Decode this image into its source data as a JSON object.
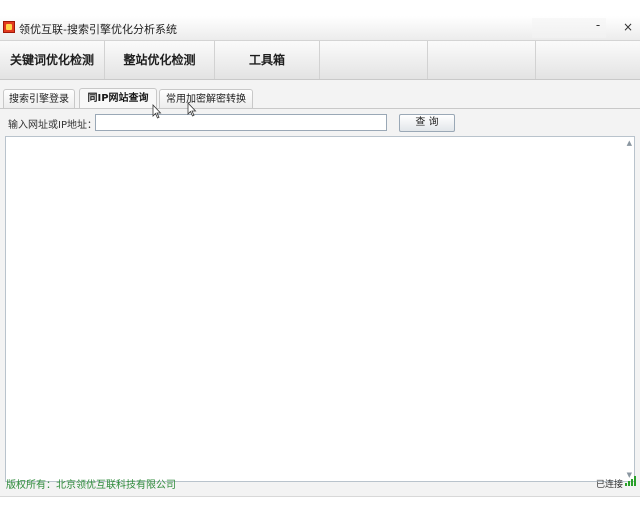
{
  "window": {
    "title": "领优互联-搜索引擎优化分析系统",
    "minimize_glyph": "-",
    "close_glyph": "×"
  },
  "nav": {
    "items": [
      {
        "label": "关键词优化检测"
      },
      {
        "label": "整站优化检测"
      },
      {
        "label": "工具箱"
      }
    ]
  },
  "tabs": [
    {
      "label": "搜索引擎登录",
      "active": false
    },
    {
      "label": "同IP网站查询",
      "active": true
    },
    {
      "label": "常用加密解密转换",
      "active": false
    }
  ],
  "search": {
    "label": "输入网址或IP地址：",
    "value": "",
    "button": "查 询"
  },
  "results": {
    "scroll_up": "▲",
    "scroll_down": "▼"
  },
  "status": {
    "copyright": "版权所有：北京领优互联科技有限公司",
    "connection": "已连接"
  },
  "colors": {
    "accent_green": "#2e8b3a",
    "icon_red": "#e23a1e",
    "signal_green": "#2aa02a"
  },
  "icons": [
    "app-icon",
    "signal-icon",
    "pointer-cursor-icon"
  ]
}
